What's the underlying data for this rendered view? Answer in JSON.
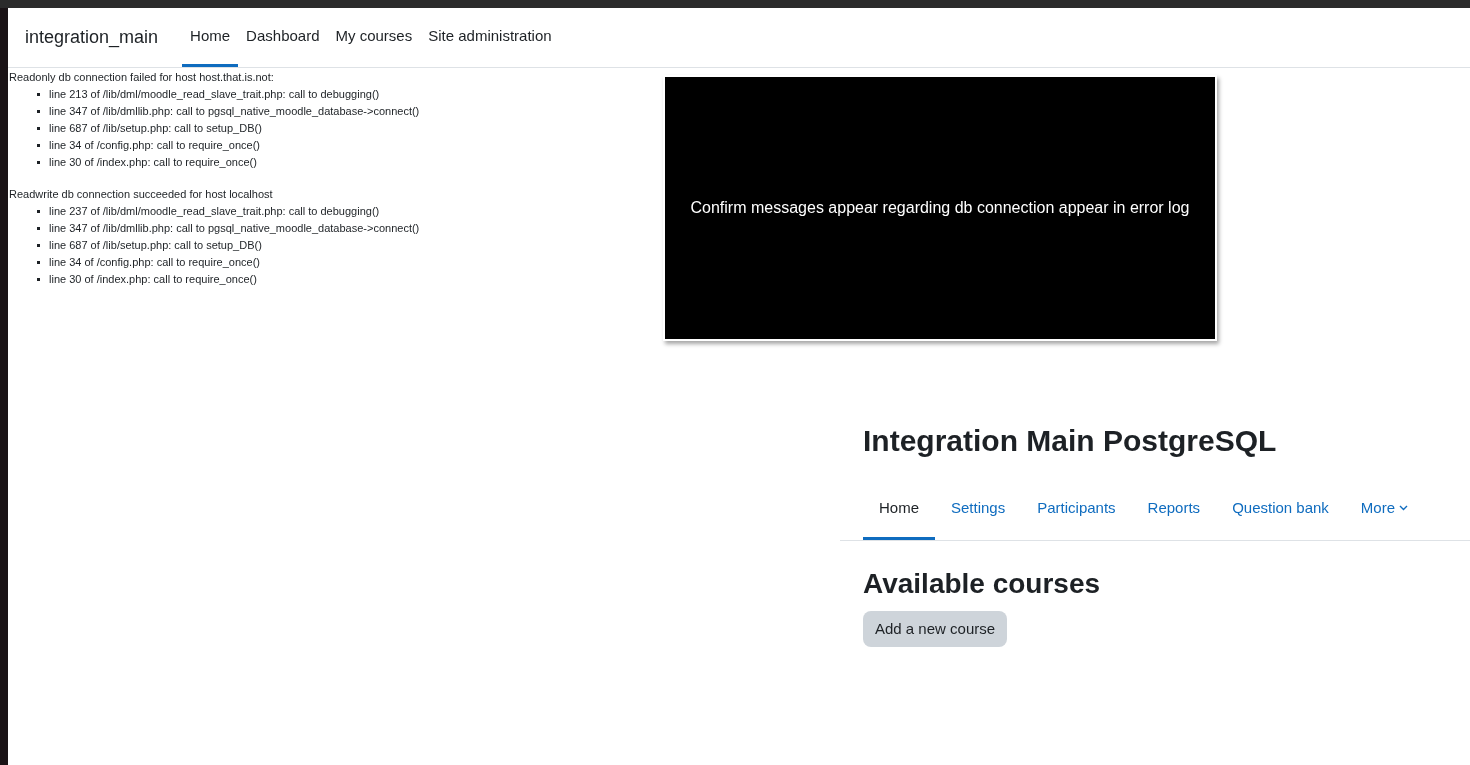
{
  "navbar": {
    "brand": "integration_main",
    "items": [
      {
        "label": "Home",
        "selected": true
      },
      {
        "label": "Dashboard",
        "selected": false
      },
      {
        "label": "My courses",
        "selected": false
      },
      {
        "label": "Site administration",
        "selected": false
      }
    ]
  },
  "debug_messages": [
    {
      "message": "Readonly db connection failed for host host.that.is.not:",
      "trace": [
        "line 213 of /lib/dml/moodle_read_slave_trait.php: call to debugging()",
        "line 347 of /lib/dmllib.php: call to pgsql_native_moodle_database->connect()",
        "line 687 of /lib/setup.php: call to setup_DB()",
        "line 34 of /config.php: call to require_once()",
        "line 30 of /index.php: call to require_once()"
      ]
    },
    {
      "message": "Readwrite db connection succeeded for host localhost",
      "trace": [
        "line 237 of /lib/dml/moodle_read_slave_trait.php: call to debugging()",
        "line 347 of /lib/dmllib.php: call to pgsql_native_moodle_database->connect()",
        "line 687 of /lib/setup.php: call to setup_DB()",
        "line 34 of /config.php: call to require_once()",
        "line 30 of /index.php: call to require_once()"
      ]
    }
  ],
  "overlay": {
    "text": "Confirm messages appear regarding db connection appear in error log"
  },
  "course": {
    "title": "Integration Main PostgreSQL",
    "tabs": [
      {
        "label": "Home",
        "selected": true,
        "kind": "link"
      },
      {
        "label": "Settings",
        "selected": false,
        "kind": "link"
      },
      {
        "label": "Participants",
        "selected": false,
        "kind": "link"
      },
      {
        "label": "Reports",
        "selected": false,
        "kind": "link"
      },
      {
        "label": "Question bank",
        "selected": false,
        "kind": "link"
      },
      {
        "label": "More",
        "selected": false,
        "kind": "menu"
      }
    ],
    "section_title": "Available courses",
    "button": "Add a new course"
  }
}
